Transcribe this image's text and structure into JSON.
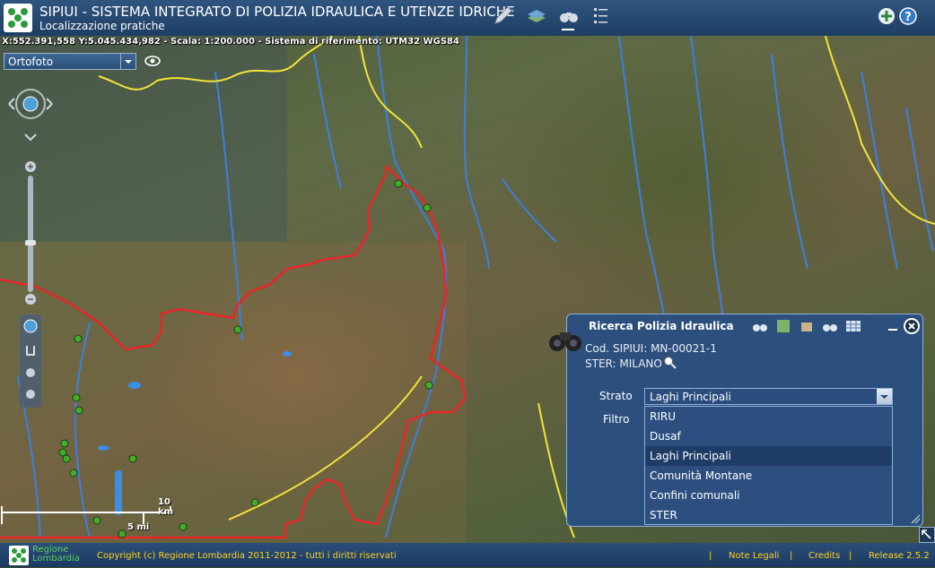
{
  "header": {
    "title": "SIPIUI - SISTEMA INTEGRATO DI POLIZIA IDRAULICA E UTENZE IDRICHE",
    "subtitle": "Localizzazione pratiche"
  },
  "map_info": {
    "coords": "X:552.391,558 Y:5.045.434,982 - Scala: 1:200.000 - Sistema di riferimento: UTM32 WGS84"
  },
  "layer_select": {
    "value": "Ortofoto"
  },
  "scale": {
    "km": "10 km",
    "mi": "5 mi"
  },
  "panel": {
    "title": "Ricerca Polizia Idraulica",
    "cod": "Cod. SIPIUI: MN-00021-1",
    "ster": "STER: MILANO",
    "strato_label": "Strato",
    "filtro_label": "Filtro",
    "strato_value": "Laghi Principali",
    "options": [
      "RIRU",
      "Dusaf",
      "Laghi Principali",
      "Comunità Montane",
      "Confini comunali",
      "STER"
    ],
    "selected_option": "Laghi Principali"
  },
  "footer": {
    "brand_line1": "Regione",
    "brand_line2": "Lombardia",
    "copyright": "Copyright (c) Regione Lombardia 2011-2012 - tutti i diritti riservati",
    "note_legali": "Note Legali",
    "credits": "Credits",
    "release": "Release 2.5.2",
    "separator": "|"
  },
  "colors": {
    "header_bg": "#1e3e63",
    "panel_bg": "#284e82",
    "boundary_red": "#e8262a",
    "boundary_yellow": "#f2e33a",
    "river_blue": "#3c7fe0",
    "point_green": "#3fae2a",
    "footer_text": "#ffd21f"
  },
  "icons": [
    "pencil-icon",
    "layers-icon",
    "binoculars-icon",
    "list-icon",
    "add-icon",
    "help-icon",
    "eye-icon",
    "close-icon",
    "minimize-icon",
    "zoom-icon",
    "resize-icon"
  ]
}
